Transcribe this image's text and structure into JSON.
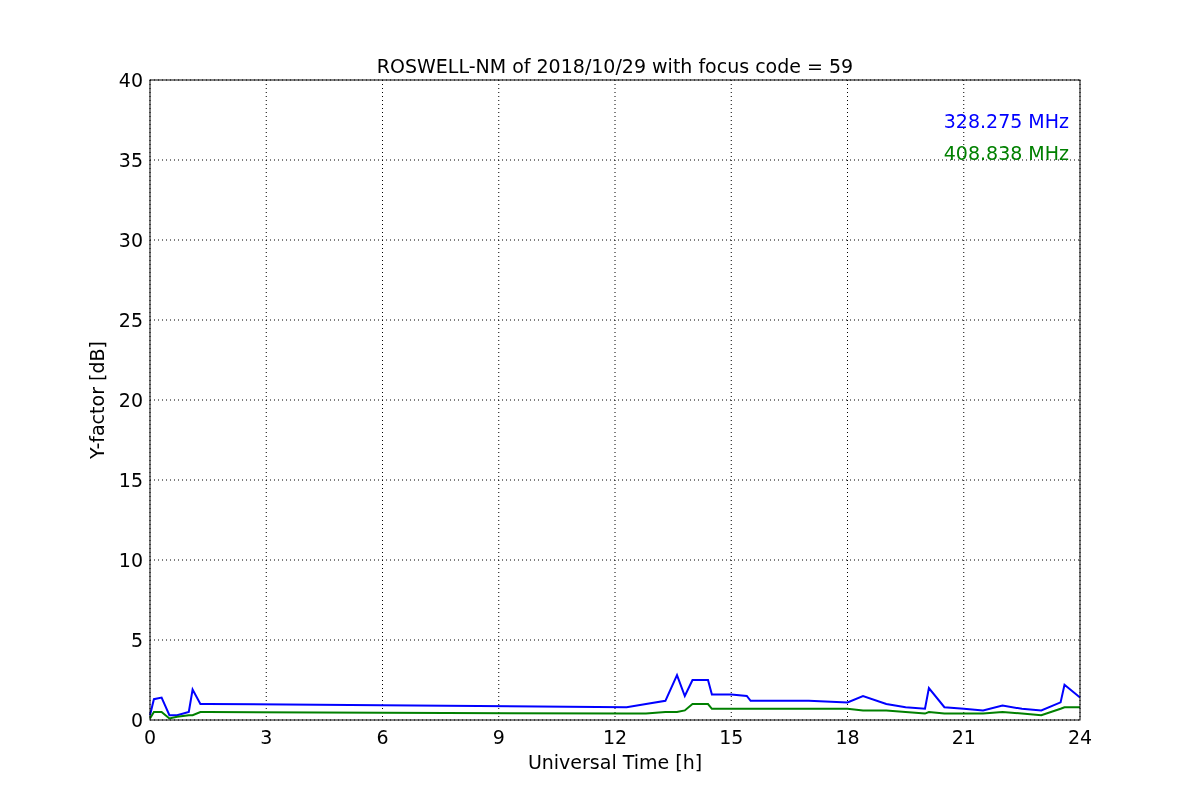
{
  "chart_data": {
    "type": "line",
    "title": "ROSWELL-NM of 2018/10/29 with focus code = 59",
    "xlabel": "Universal Time [h]",
    "ylabel": "Y-factor [dB]",
    "x": [
      0,
      0.1,
      0.3,
      0.5,
      0.7,
      1.0,
      1.1,
      1.3,
      1.5,
      12.3,
      12.8,
      13.3,
      13.6,
      13.8,
      14.0,
      14.4,
      14.5,
      15.0,
      15.4,
      15.5,
      16,
      17,
      18,
      18.4,
      19,
      19.5,
      20,
      20.1,
      20.5,
      21,
      21.5,
      22,
      22.5,
      23,
      23.5,
      23.6,
      24
    ],
    "series": [
      {
        "name": "328.275 MHz",
        "color": "#0000ff",
        "values": [
          0.3,
          1.3,
          1.4,
          0.3,
          0.3,
          0.5,
          1.9,
          1.0,
          1.0,
          0.8,
          1.0,
          1.2,
          2.8,
          1.5,
          2.5,
          2.5,
          1.6,
          1.6,
          1.5,
          1.2,
          1.2,
          1.2,
          1.1,
          1.5,
          1.0,
          0.8,
          0.7,
          2.0,
          0.8,
          0.7,
          0.6,
          0.9,
          0.7,
          0.6,
          1.1,
          2.2,
          1.4
        ]
      },
      {
        "name": "408.838 MHz",
        "color": "#008000",
        "values": [
          0.1,
          0.5,
          0.5,
          0.1,
          0.2,
          0.3,
          0.3,
          0.5,
          0.5,
          0.4,
          0.4,
          0.5,
          0.5,
          0.6,
          1.0,
          1.0,
          0.7,
          0.7,
          0.7,
          0.7,
          0.7,
          0.7,
          0.7,
          0.6,
          0.6,
          0.5,
          0.4,
          0.5,
          0.4,
          0.4,
          0.4,
          0.5,
          0.4,
          0.3,
          0.7,
          0.8,
          0.8
        ]
      }
    ],
    "grid": true,
    "xlim": [
      0,
      24
    ],
    "ylim": [
      0,
      40
    ],
    "xticks": [
      0,
      3,
      6,
      9,
      12,
      15,
      18,
      21,
      24
    ],
    "yticks": [
      0,
      5,
      10,
      15,
      20,
      25,
      30,
      35,
      40
    ]
  }
}
